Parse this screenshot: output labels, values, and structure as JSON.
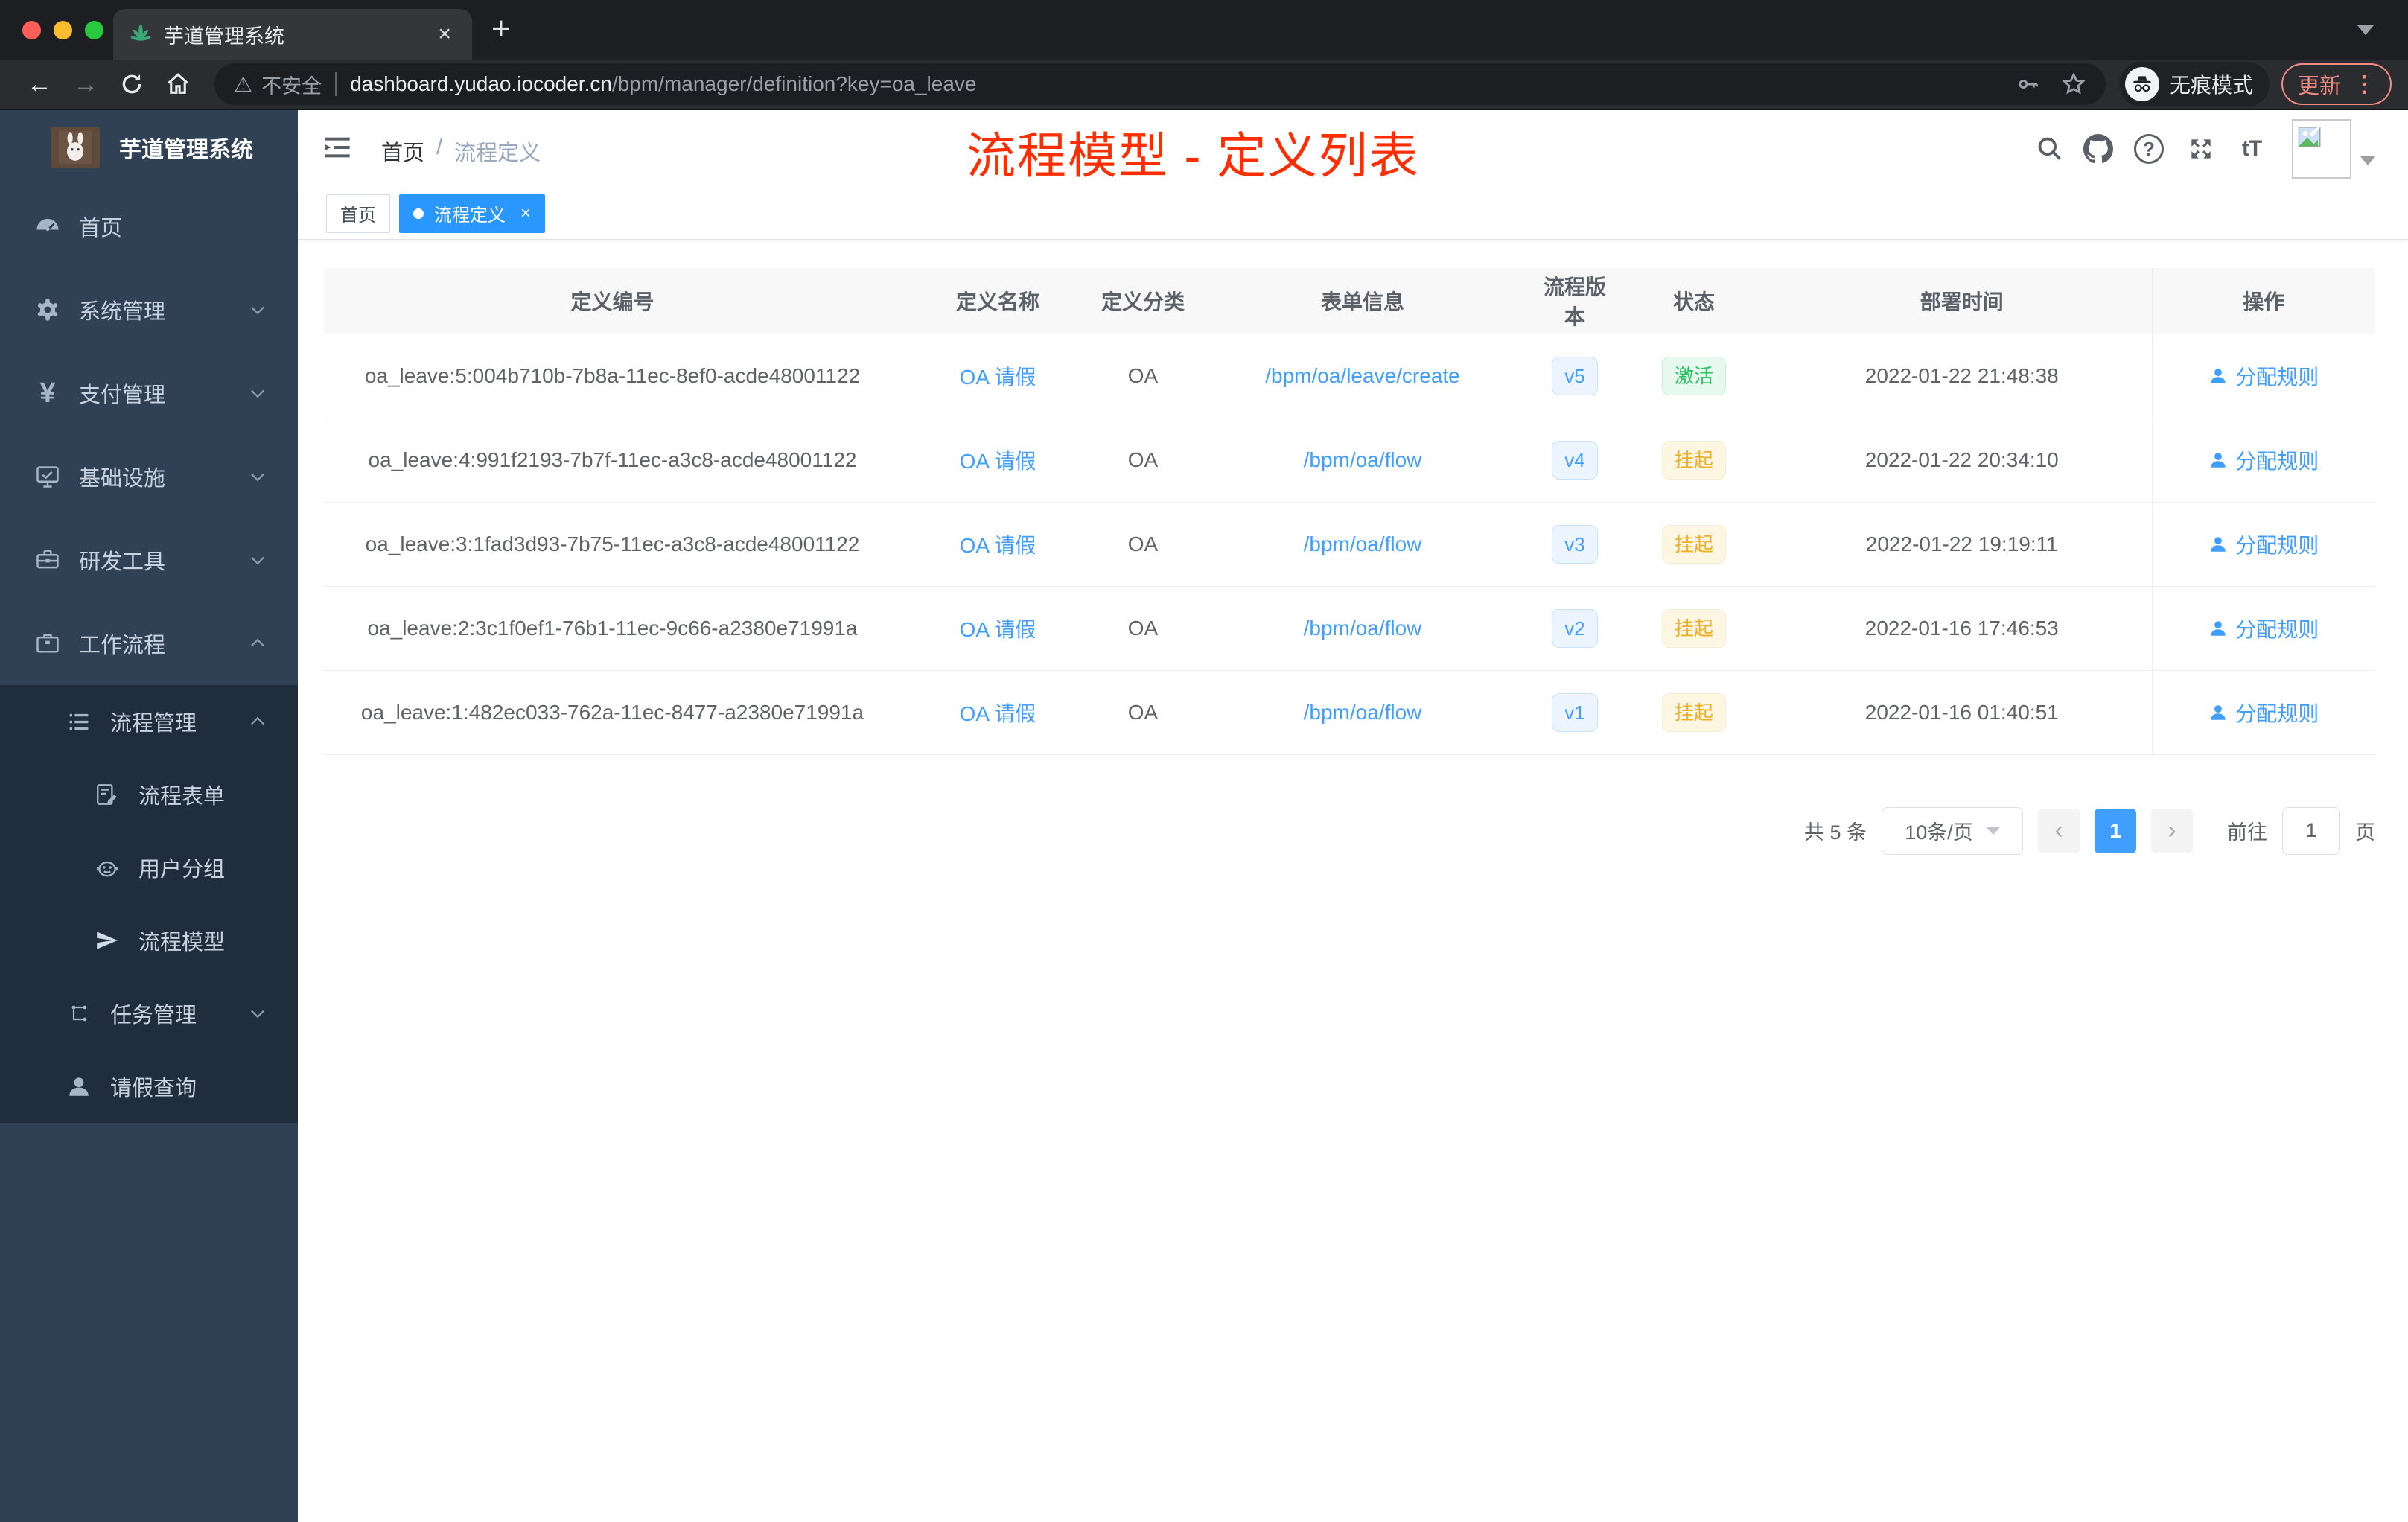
{
  "browser": {
    "tab_title": "芋道管理系统",
    "tab_close": "×",
    "new_tab": "+",
    "insecure_label": "不安全",
    "url_domain": "dashboard.yudao.iocoder.cn",
    "url_path": "/bpm/manager/definition?key=oa_leave",
    "incognito_label": "无痕模式",
    "update_label": "更新",
    "kebab": "⋮"
  },
  "sidebar": {
    "brand": "芋道管理系统",
    "items": [
      {
        "label": "首页"
      },
      {
        "label": "系统管理"
      },
      {
        "label": "支付管理"
      },
      {
        "label": "基础设施"
      },
      {
        "label": "研发工具"
      },
      {
        "label": "工作流程"
      },
      {
        "label": "流程管理"
      },
      {
        "label": "流程表单"
      },
      {
        "label": "用户分组"
      },
      {
        "label": "流程模型"
      },
      {
        "label": "任务管理"
      },
      {
        "label": "请假查询"
      }
    ]
  },
  "header": {
    "breadcrumb_home": "首页",
    "breadcrumb_sep": "/",
    "breadcrumb_current": "流程定义",
    "overlay_title": "流程模型 - 定义列表",
    "help_glyph": "?",
    "font_glyph": "tT"
  },
  "tags": {
    "home": "首页",
    "active": "流程定义",
    "close": "×"
  },
  "table": {
    "headers": [
      "定义编号",
      "定义名称",
      "定义分类",
      "表单信息",
      "流程版本",
      "状态",
      "部署时间",
      "操作"
    ],
    "action_label": "分配规则",
    "rows": [
      {
        "id": "oa_leave:5:004b710b-7b8a-11ec-8ef0-acde48001122",
        "name": "OA 请假",
        "category": "OA",
        "form": "/bpm/oa/leave/create",
        "version": "v5",
        "status": "激活",
        "time": "2022-01-22 21:48:38"
      },
      {
        "id": "oa_leave:4:991f2193-7b7f-11ec-a3c8-acde48001122",
        "name": "OA 请假",
        "category": "OA",
        "form": "/bpm/oa/flow",
        "version": "v4",
        "status": "挂起",
        "time": "2022-01-22 20:34:10"
      },
      {
        "id": "oa_leave:3:1fad3d93-7b75-11ec-a3c8-acde48001122",
        "name": "OA 请假",
        "category": "OA",
        "form": "/bpm/oa/flow",
        "version": "v3",
        "status": "挂起",
        "time": "2022-01-22 19:19:11"
      },
      {
        "id": "oa_leave:2:3c1f0ef1-76b1-11ec-9c66-a2380e71991a",
        "name": "OA 请假",
        "category": "OA",
        "form": "/bpm/oa/flow",
        "version": "v2",
        "status": "挂起",
        "time": "2022-01-16 17:46:53"
      },
      {
        "id": "oa_leave:1:482ec033-762a-11ec-8477-a2380e71991a",
        "name": "OA 请假",
        "category": "OA",
        "form": "/bpm/oa/flow",
        "version": "v1",
        "status": "挂起",
        "time": "2022-01-16 01:40:51"
      }
    ]
  },
  "pagination": {
    "total_label": "共 5 条",
    "page_size": "10条/页",
    "prev": "‹",
    "page": "1",
    "next": "›",
    "goto_label": "前往",
    "goto_value": "1",
    "unit_label": "页"
  },
  "colors": {
    "accent": "#409eff",
    "tag_active": "#2a97ff",
    "status_active": "#27c45f",
    "status_suspended": "#eeb020",
    "overlay_red": "#ff2e00",
    "sidebar_bg": "#304156",
    "submenu_bg": "#1f2d3d"
  }
}
